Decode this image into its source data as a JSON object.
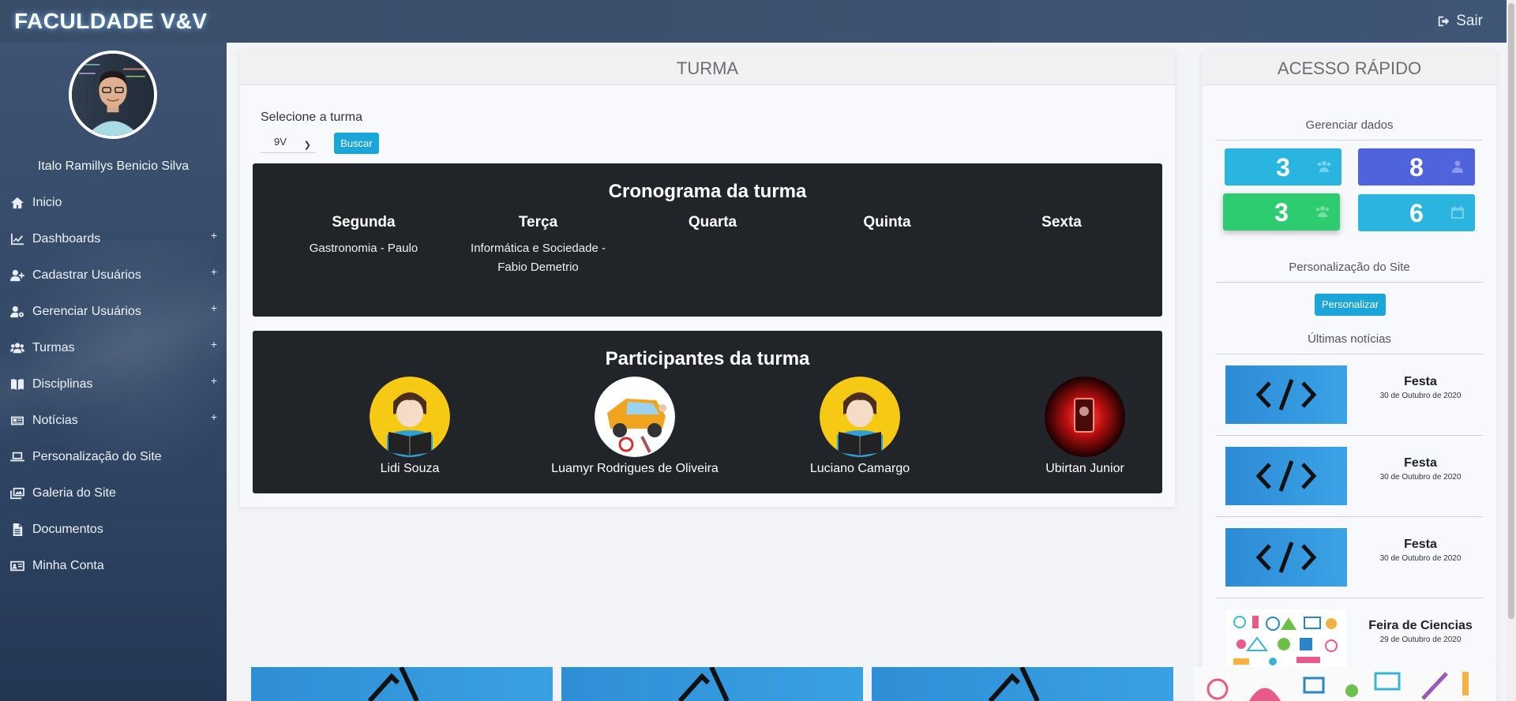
{
  "brand": "FACULDADE V&V",
  "logout": {
    "label": "Sair",
    "icon": "sign-out-icon"
  },
  "user": {
    "name": "Italo Ramillys Benicio Silva"
  },
  "nav": [
    {
      "label": "Inicio",
      "icon": "home-icon",
      "expandable": false
    },
    {
      "label": "Dashboards",
      "icon": "chart-line-icon",
      "expandable": true
    },
    {
      "label": "Cadastrar Usuários",
      "icon": "user-plus-icon",
      "expandable": true
    },
    {
      "label": "Gerenciar Usuários",
      "icon": "user-cog-icon",
      "expandable": true
    },
    {
      "label": "Turmas",
      "icon": "users-icon",
      "expandable": true
    },
    {
      "label": "Disciplinas",
      "icon": "book-open-icon",
      "expandable": true
    },
    {
      "label": "Notícias",
      "icon": "newspaper-icon",
      "expandable": true
    },
    {
      "label": "Personalização do Site",
      "icon": "laptop-icon",
      "expandable": false
    },
    {
      "label": "Galeria do Site",
      "icon": "images-icon",
      "expandable": false
    },
    {
      "label": "Documentos",
      "icon": "file-icon",
      "expandable": false
    },
    {
      "label": "Minha Conta",
      "icon": "id-card-icon",
      "expandable": false
    }
  ],
  "turma": {
    "title": "TURMA",
    "select_label": "Selecione a turma",
    "selected": "9V",
    "search_button": "Buscar",
    "schedule": {
      "title": "Cronograma da turma",
      "days": [
        {
          "name": "Segunda",
          "classes": [
            "Gastronomia - Paulo"
          ]
        },
        {
          "name": "Terça",
          "classes": [
            "Informática e Sociedade -",
            "Fabio Demetrio"
          ]
        },
        {
          "name": "Quarta",
          "classes": []
        },
        {
          "name": "Quinta",
          "classes": []
        },
        {
          "name": "Sexta",
          "classes": []
        }
      ]
    },
    "participants": {
      "title": "Participantes da turma",
      "members": [
        {
          "name": "Lidi Souza",
          "avatar": "reading-boy"
        },
        {
          "name": "Luamyr Rodrigues de Oliveira",
          "avatar": "car-crash"
        },
        {
          "name": "Luciano Camargo",
          "avatar": "reading-boy"
        },
        {
          "name": "Ubirtan Junior",
          "avatar": "red-glow"
        }
      ]
    }
  },
  "acesso": {
    "title": "ACESSO RÁPIDO",
    "manage_title": "Gerenciar dados",
    "stats": [
      {
        "value": "3",
        "icon": "users-icon",
        "color": "#29b5e0"
      },
      {
        "value": "8",
        "icon": "user-tie-icon",
        "color": "#4e63dc"
      },
      {
        "value": "3",
        "icon": "users-icon",
        "color": "#2ecc71"
      },
      {
        "value": "6",
        "icon": "calendar-icon",
        "color": "#29b5e0"
      }
    ],
    "personalize_title": "Personalização do Site",
    "personalize_button": "Personalizar",
    "news_title": "Últimas notícias",
    "news": [
      {
        "title": "Festa",
        "date": "30 de Outubro de 2020",
        "thumb": "code"
      },
      {
        "title": "Festa",
        "date": "30 de Outubro de 2020",
        "thumb": "code"
      },
      {
        "title": "Festa",
        "date": "30 de Outubro de 2020",
        "thumb": "code"
      },
      {
        "title": "Feira de Ciencias",
        "date": "29 de Outubro de 2020",
        "thumb": "science"
      }
    ]
  }
}
